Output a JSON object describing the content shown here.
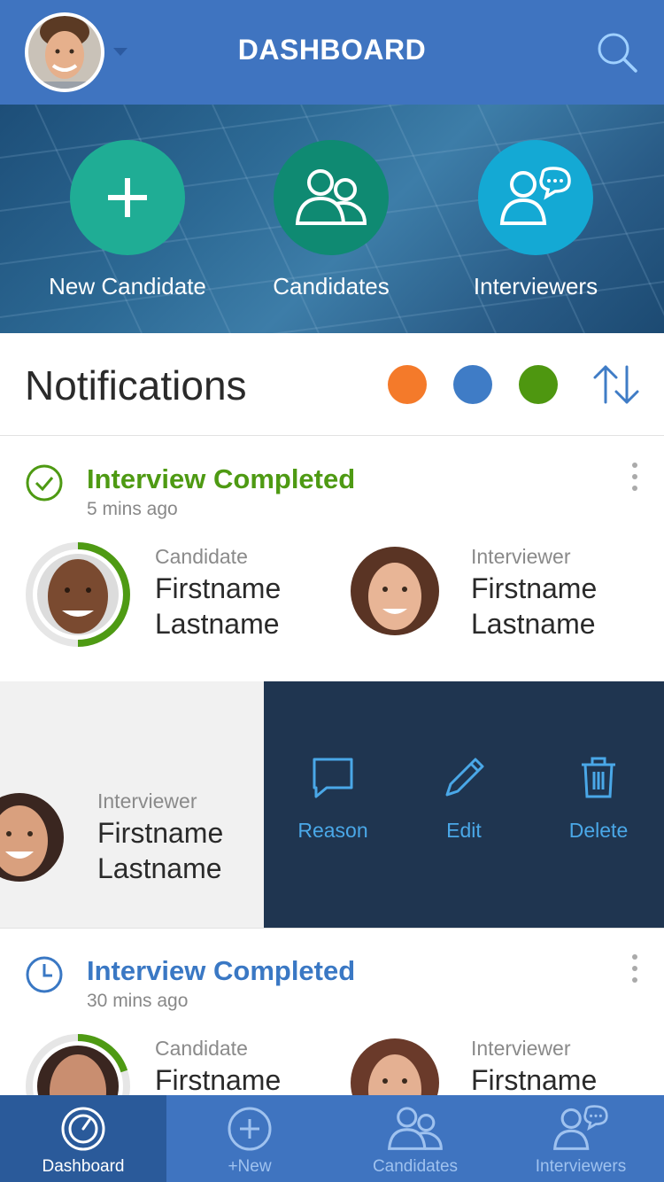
{
  "header": {
    "title": "DASHBOARD"
  },
  "hero": {
    "actions": [
      {
        "label": "New Candidate",
        "color": "#1fad95",
        "icon": "plus-icon"
      },
      {
        "label": "Candidates",
        "color": "#0f8a72",
        "icon": "group-icon"
      },
      {
        "label": "Interviewers",
        "color": "#14a9d4",
        "icon": "interviewers-icon"
      }
    ]
  },
  "notifications": {
    "title": "Notifications",
    "filters": [
      {
        "color": "#f47a2a"
      },
      {
        "color": "#3f7cc6"
      },
      {
        "color": "#4e9710"
      }
    ],
    "items": [
      {
        "title": "Interview Completed",
        "time": "5 mins ago",
        "title_color": "#4e9a13",
        "status_icon": "check-circle-icon",
        "progress": 0.5,
        "candidate": {
          "role": "Candidate",
          "first": "Firstname",
          "last": "Lastname"
        },
        "interviewer": {
          "role": "Interviewer",
          "first": "Firstname",
          "last": "Lastname"
        }
      },
      {
        "swiped": true,
        "interviewer": {
          "role": "Interviewer",
          "first": "Firstname",
          "last": "Lastname"
        },
        "actions": [
          {
            "label": "Reason",
            "icon": "comment-icon"
          },
          {
            "label": "Edit",
            "icon": "pencil-icon"
          },
          {
            "label": "Delete",
            "icon": "trash-icon"
          }
        ]
      },
      {
        "title": "Interview Completed",
        "time": "30 mins ago",
        "title_color": "#3a78c4",
        "status_icon": "clock-icon",
        "progress": 0.2,
        "candidate": {
          "role": "Candidate",
          "first": "Firstname"
        },
        "interviewer": {
          "role": "Interviewer",
          "first": "Firstname"
        }
      }
    ]
  },
  "tabbar": {
    "active": "Dashboard",
    "tabs": [
      {
        "label": "Dashboard",
        "icon": "gauge-icon"
      },
      {
        "label": "+New",
        "icon": "plus-circle-icon"
      },
      {
        "label": "Candidates",
        "icon": "group-icon"
      },
      {
        "label": "Interviewers",
        "icon": "interviewers-icon"
      }
    ]
  }
}
